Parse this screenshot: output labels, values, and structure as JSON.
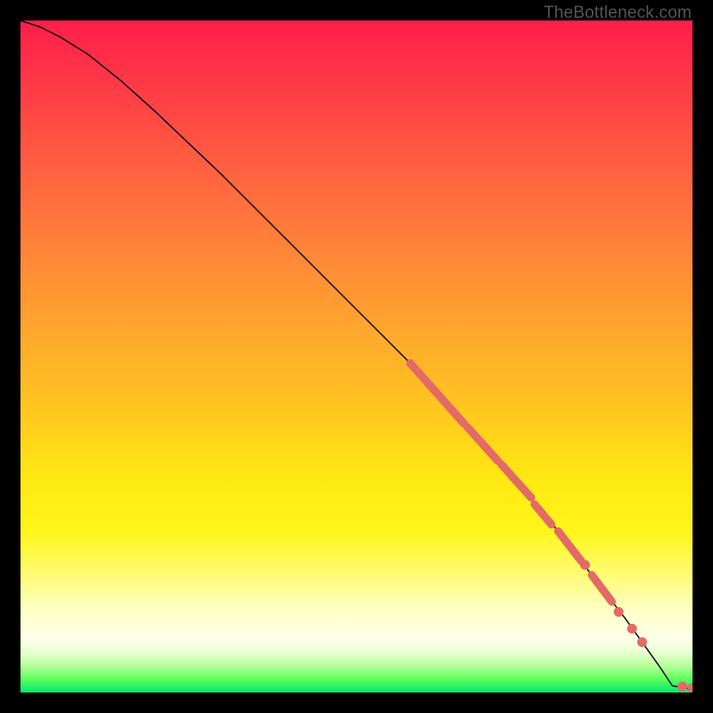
{
  "attribution": "TheBottleneck.com",
  "chart_data": {
    "type": "line",
    "title": "",
    "xlabel": "",
    "ylabel": "",
    "xlim": [
      0,
      100
    ],
    "ylim": [
      0,
      100
    ],
    "curve": {
      "x": [
        0,
        3,
        6,
        10,
        15,
        20,
        30,
        40,
        50,
        60,
        70,
        80,
        90,
        95,
        97,
        100
      ],
      "y": [
        100,
        99,
        97.5,
        95,
        91,
        86.5,
        77,
        67,
        57,
        47,
        36,
        24,
        11,
        4,
        1,
        0.5
      ]
    },
    "highlight_segments": [
      {
        "x1": 58,
        "y1": 49,
        "x2": 66,
        "y2": 40
      },
      {
        "x1": 66.5,
        "y1": 39.5,
        "x2": 71,
        "y2": 34.5
      },
      {
        "x1": 71.5,
        "y1": 34,
        "x2": 76,
        "y2": 29
      },
      {
        "x1": 76.5,
        "y1": 28,
        "x2": 79,
        "y2": 25
      },
      {
        "x1": 80,
        "y1": 24,
        "x2": 83.5,
        "y2": 19.5
      },
      {
        "x1": 85,
        "y1": 17.5,
        "x2": 88,
        "y2": 13.5
      }
    ],
    "highlight_points": [
      {
        "x": 84,
        "y": 19
      },
      {
        "x": 89,
        "y": 12
      },
      {
        "x": 91,
        "y": 9.5
      },
      {
        "x": 92.5,
        "y": 7.5
      },
      {
        "x": 98.5,
        "y": 0.9
      },
      {
        "x": 100,
        "y": 0.7
      }
    ]
  }
}
